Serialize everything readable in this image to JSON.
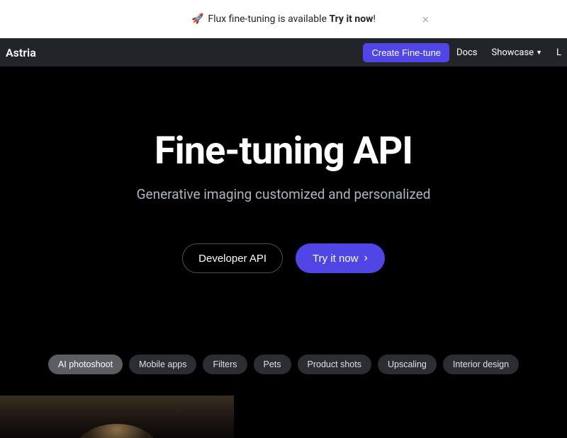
{
  "announcement": {
    "icon": "🚀",
    "text_prefix": "Flux fine-tuning is available ",
    "text_bold": "Try it now",
    "text_suffix": "!",
    "close": "×"
  },
  "nav": {
    "brand": "Astria",
    "create": "Create Fine-tune",
    "docs": "Docs",
    "showcase": "Showcase",
    "extra": "L"
  },
  "hero": {
    "title": "Fine-tuning API",
    "subtitle": "Generative imaging customized and personalized",
    "btn_dev": "Developer API",
    "btn_try": "Try it now"
  },
  "pills": [
    "AI photoshoot",
    "Mobile apps",
    "Filters",
    "Pets",
    "Product shots",
    "Upscaling",
    "Interior design"
  ]
}
